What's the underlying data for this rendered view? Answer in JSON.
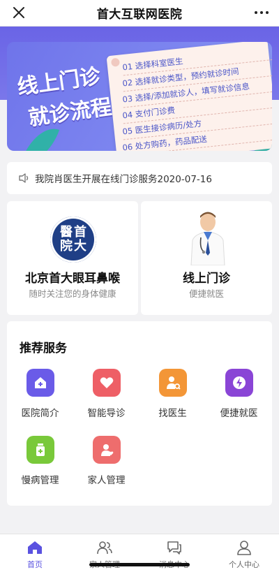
{
  "header": {
    "title": "首大互联网医院",
    "close_icon": "close-icon",
    "more_icon": "more-icon"
  },
  "banner": {
    "title_line1": "线上门诊",
    "title_line2": "就诊流程",
    "steps": [
      "01 选择科室医生",
      "02 选择就诊类型，预约就诊时间",
      "03 选择/添加就诊人，填写就诊信息",
      "04 支付门诊费",
      "05 医生接诊病历/处方",
      "06 处方购药，药品配送"
    ]
  },
  "notice": {
    "icon": "speaker-icon",
    "text": "我院肖医生开展在线门诊服务2020-07-16"
  },
  "cards": [
    {
      "seal_text": "醫首院大",
      "title": "北京首大眼耳鼻喉",
      "subtitle": "随时关注您的身体健康"
    },
    {
      "title": "线上门诊",
      "subtitle": "便捷就医"
    }
  ],
  "services": {
    "title": "推荐服务",
    "items": [
      {
        "label": "医院简介",
        "icon": "hospital-icon",
        "color": "#6a5be8"
      },
      {
        "label": "智能导诊",
        "icon": "heart-icon",
        "color": "#ee5f66"
      },
      {
        "label": "找医生",
        "icon": "doctor-search-icon",
        "color": "#f39637"
      },
      {
        "label": "便捷就医",
        "icon": "lightning-icon",
        "color": "#8a45d6"
      },
      {
        "label": "慢病管理",
        "icon": "medicine-bottle-icon",
        "color": "#79c93a"
      },
      {
        "label": "家人管理",
        "icon": "family-icon",
        "color": "#ee6d6d"
      }
    ]
  },
  "tabbar": {
    "active_color": "#5a52e0",
    "items": [
      {
        "label": "首页",
        "icon": "home-icon"
      },
      {
        "label": "家人管理",
        "icon": "family-tab-icon"
      },
      {
        "label": "消息中心",
        "icon": "message-icon"
      },
      {
        "label": "个人中心",
        "icon": "profile-icon"
      }
    ]
  }
}
